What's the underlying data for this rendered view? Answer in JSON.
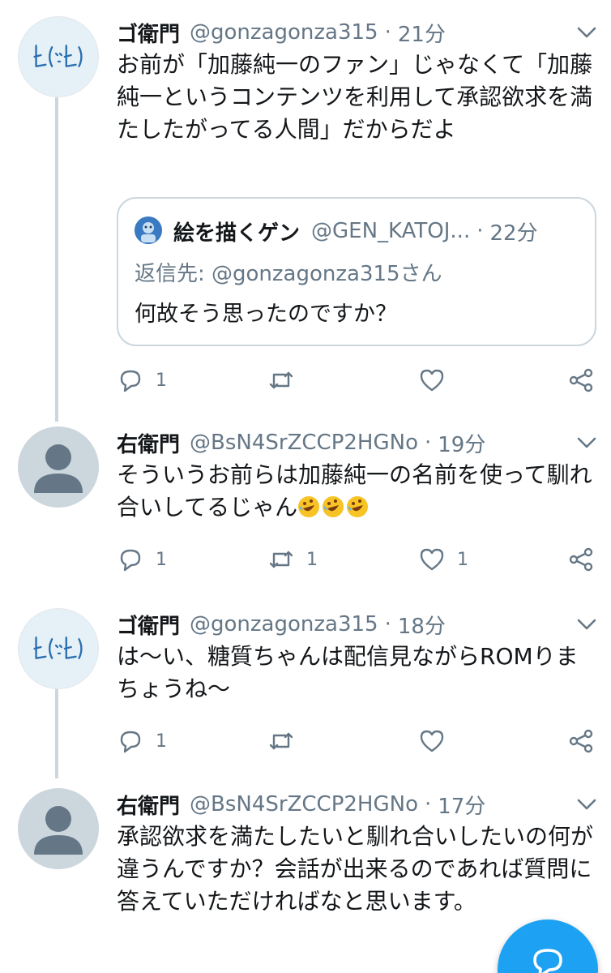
{
  "tweets": [
    {
      "name": "ゴ衛門",
      "handle": "@gonzagonza315",
      "time": "21分",
      "text": "お前が「加藤純一のファン」じゃなくて「加藤純一というコンテンツを利用して承認欲求を満たしたがってる人間」だからだよ",
      "reply_count": "1",
      "retweet_count": "",
      "like_count": ""
    },
    {
      "name": "右衛門",
      "handle": "@BsN4SrZCCP2HGNo",
      "time": "19分",
      "text": "そういうお前らは加藤純一の名前を使って馴れ合いしてるじゃん",
      "emoji": [
        "rofl-emoji",
        "rofl-emoji",
        "rofl-emoji"
      ],
      "reply_count": "1",
      "retweet_count": "1",
      "like_count": "1"
    },
    {
      "name": "ゴ衛門",
      "handle": "@gonzagonza315",
      "time": "18分",
      "text": "は〜い、糖質ちゃんは配信見ながらROMりまちょうね〜",
      "reply_count": "1",
      "retweet_count": "",
      "like_count": ""
    },
    {
      "name": "右衛門",
      "handle": "@BsN4SrZCCP2HGNo",
      "time": "17分",
      "text": "承認欲求を満たしたいと馴れ合いしたいの何が違うんですか？会話が出来るのであれば質問に答えていただければなと思います。"
    }
  ],
  "quote": {
    "name": "絵を描くゲン",
    "handle": "@GEN_KATOJ...",
    "time": "22分",
    "reply_to": "返信先: @gonzagonza315さん",
    "text": "何故そう思ったのですか？"
  },
  "separator": "·",
  "colors": {
    "accent": "#1da1f2",
    "text": "#14171a",
    "secondary": "#657786",
    "border": "#ccd6dd"
  },
  "icons": [
    "reply-icon",
    "retweet-icon",
    "like-icon",
    "share-icon",
    "caret-down-icon",
    "compose-reply-icon"
  ]
}
